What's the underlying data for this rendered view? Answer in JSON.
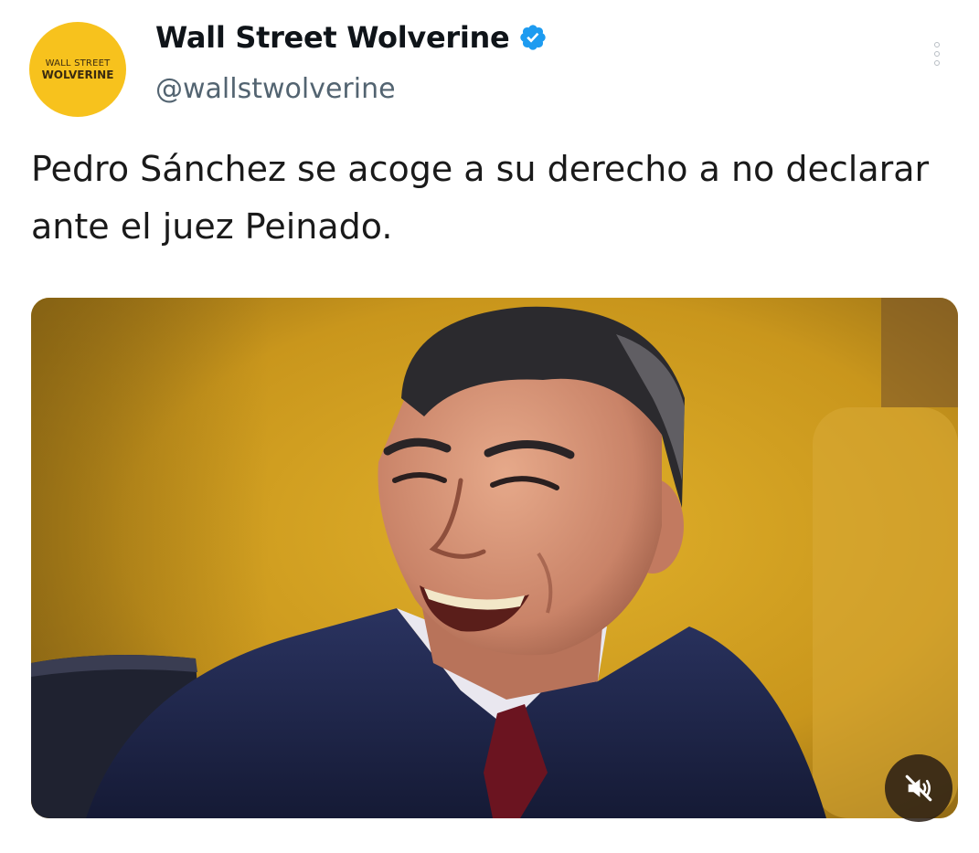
{
  "account": {
    "avatar_line1": "WALL STREET",
    "avatar_line2": "WOLVERINE",
    "display_name": "Wall Street Wolverine",
    "handle": "@wallstwolverine",
    "verified": true,
    "verified_icon": "verified-badge-icon",
    "avatar_color": "#f7c21d",
    "verified_color": "#1d9bf0"
  },
  "post": {
    "text": "Pedro Sánchez se acoge a su derecho a no declarar ante el juez Peinado."
  },
  "media": {
    "type": "video",
    "muted": true,
    "mute_icon": "speaker-muted-icon"
  },
  "actions": {
    "more_icon": "more-options-icon"
  }
}
